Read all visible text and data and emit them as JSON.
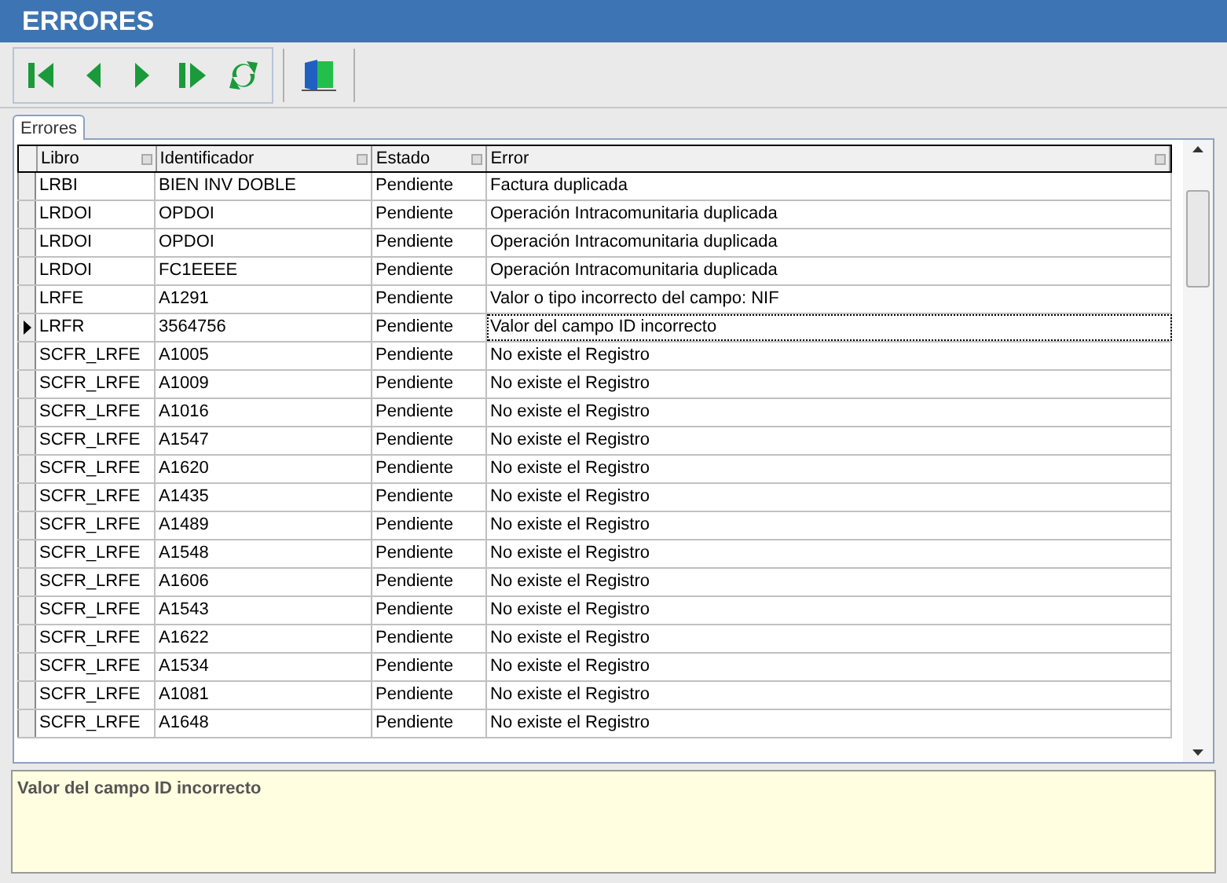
{
  "window": {
    "title": "ERRORES"
  },
  "tabs": [
    {
      "label": "Errores",
      "selected": true
    }
  ],
  "table": {
    "columns": [
      "Libro",
      "Identificador",
      "Estado",
      "Error"
    ],
    "rows": [
      {
        "cells": [
          "LRBI",
          "BIEN INV DOBLE",
          "Pendiente",
          "Factura duplicada"
        ],
        "selected": false
      },
      {
        "cells": [
          "LRDOI",
          "OPDOI",
          "Pendiente",
          "Operación Intracomunitaria duplicada"
        ],
        "selected": false
      },
      {
        "cells": [
          "LRDOI",
          "OPDOI",
          "Pendiente",
          "Operación Intracomunitaria duplicada"
        ],
        "selected": false
      },
      {
        "cells": [
          "LRDOI",
          "FC1EEEE",
          "Pendiente",
          "Operación Intracomunitaria duplicada"
        ],
        "selected": false
      },
      {
        "cells": [
          "LRFE",
          "A1291",
          "Pendiente",
          "Valor o tipo incorrecto del campo: NIF"
        ],
        "selected": false
      },
      {
        "cells": [
          "LRFR",
          "3564756",
          "Pendiente",
          "Valor del campo ID incorrecto"
        ],
        "selected": true
      },
      {
        "cells": [
          "SCFR_LRFE",
          "A1005",
          "Pendiente",
          "No existe el Registro"
        ],
        "selected": false
      },
      {
        "cells": [
          "SCFR_LRFE",
          "A1009",
          "Pendiente",
          "No existe el Registro"
        ],
        "selected": false
      },
      {
        "cells": [
          "SCFR_LRFE",
          "A1016",
          "Pendiente",
          "No existe el Registro"
        ],
        "selected": false
      },
      {
        "cells": [
          "SCFR_LRFE",
          "A1547",
          "Pendiente",
          "No existe el Registro"
        ],
        "selected": false
      },
      {
        "cells": [
          "SCFR_LRFE",
          "A1620",
          "Pendiente",
          "No existe el Registro"
        ],
        "selected": false
      },
      {
        "cells": [
          "SCFR_LRFE",
          "A1435",
          "Pendiente",
          "No existe el Registro"
        ],
        "selected": false
      },
      {
        "cells": [
          "SCFR_LRFE",
          "A1489",
          "Pendiente",
          "No existe el Registro"
        ],
        "selected": false
      },
      {
        "cells": [
          "SCFR_LRFE",
          "A1548",
          "Pendiente",
          "No existe el Registro"
        ],
        "selected": false
      },
      {
        "cells": [
          "SCFR_LRFE",
          "A1606",
          "Pendiente",
          "No existe el Registro"
        ],
        "selected": false
      },
      {
        "cells": [
          "SCFR_LRFE",
          "A1543",
          "Pendiente",
          "No existe el Registro"
        ],
        "selected": false
      },
      {
        "cells": [
          "SCFR_LRFE",
          "A1622",
          "Pendiente",
          "No existe el Registro"
        ],
        "selected": false
      },
      {
        "cells": [
          "SCFR_LRFE",
          "A1534",
          "Pendiente",
          "No existe el Registro"
        ],
        "selected": false
      },
      {
        "cells": [
          "SCFR_LRFE",
          "A1081",
          "Pendiente",
          "No existe el Registro"
        ],
        "selected": false
      },
      {
        "cells": [
          "SCFR_LRFE",
          "A1648",
          "Pendiente",
          "No existe el Registro"
        ],
        "selected": false
      }
    ]
  },
  "detail": {
    "text": "Valor del campo ID incorrecto"
  }
}
